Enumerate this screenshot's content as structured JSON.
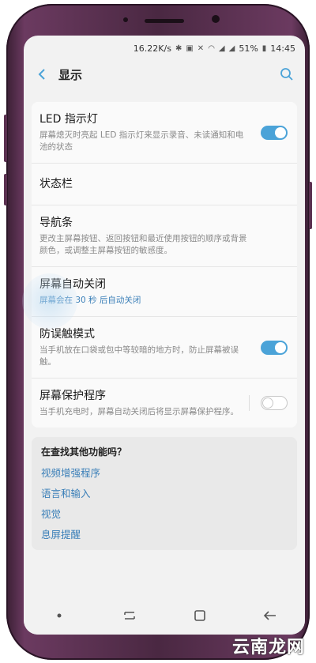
{
  "status_bar": {
    "speed": "16.22K/s",
    "battery": "51%",
    "time": "14:45"
  },
  "header": {
    "title": "显示"
  },
  "settings": [
    {
      "title": "LED 指示灯",
      "desc": "屏幕熄灭时亮起 LED 指示灯来显示录音、未读通知和电池的状态",
      "toggle": "on"
    },
    {
      "title": "状态栏",
      "desc": "",
      "toggle": "none"
    },
    {
      "title": "导航条",
      "desc": "更改主屏幕按钮、返回按钮和最近使用按钮的顺序或背景颜色，或调整主屏幕按钮的敏感度。",
      "toggle": "none"
    },
    {
      "title": "屏幕自动关闭",
      "desc": "屏幕会在 30 秒 后自动关闭",
      "toggle": "none"
    },
    {
      "title": "防误触模式",
      "desc": "当手机放在口袋或包中等较暗的地方时，防止屏幕被误触。",
      "toggle": "on"
    },
    {
      "title": "屏幕保护程序",
      "desc": "当手机充电时，屏幕自动关闭后将显示屏幕保护程序。",
      "toggle": "off"
    }
  ],
  "suggestions": {
    "title": "在查找其他功能吗？",
    "links": [
      "视频增强程序",
      "语言和输入",
      "视觉",
      "息屏提醒"
    ]
  },
  "watermark": "云南龙网",
  "colors": {
    "accent": "#4ba3d8",
    "link": "#3a7fb8",
    "phone_frame": "#4a2842"
  }
}
